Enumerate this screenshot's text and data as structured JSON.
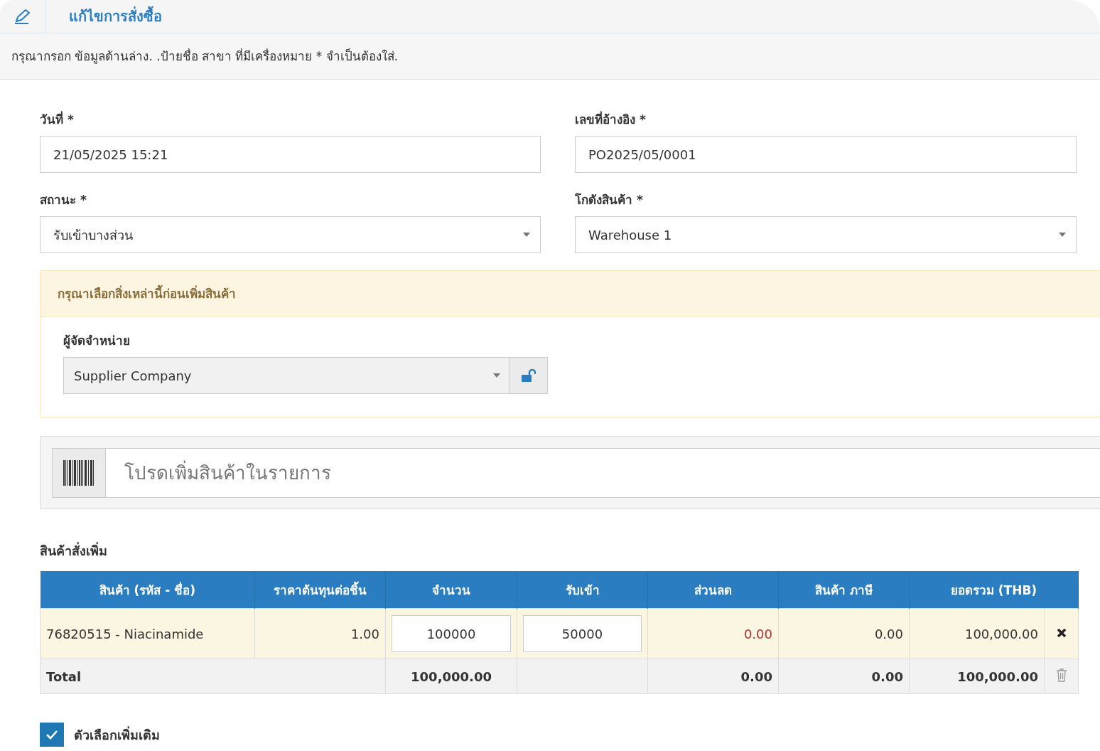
{
  "header": {
    "title": "แก้ไขการสั่งซื้อ"
  },
  "intro": "กรุณากรอก ข้อมูลด้านล่าง. .ป้ายชื่อ สาขา ที่มีเครื่องหมาย * จำเป็นต้องใส่.",
  "fields": [
    {
      "label": "วันที่ *",
      "kind": "text",
      "value": "21/05/2025 15:21"
    },
    {
      "label": "เลขที่อ้างอิง *",
      "kind": "text",
      "value": "PO2025/05/0001"
    },
    {
      "label": "สถานะ *",
      "kind": "select",
      "value": "รับเข้าบางส่วน"
    },
    {
      "label": "โกดังสินค้า *",
      "kind": "select",
      "value": "Warehouse 1"
    }
  ],
  "notice": {
    "heading": "กรุณาเลือกสิ่งเหล่านี้ก่อนเพิ่มสินค้า",
    "supplier_label": "ผู้จัดจำหน่าย",
    "supplier_value": "Supplier Company"
  },
  "product_search": {
    "placeholder": "โปรดเพิ่มสินค้าในรายการ"
  },
  "table": {
    "title": "สินค้าสั่งเพิ่ม",
    "columns": [
      "สินค้า (รหัส - ชื่อ)",
      "ราคาต้นทุนต่อชิ้น",
      "จำนวน",
      "รับเข้า",
      "ส่วนลด",
      "สินค้า ภาษี",
      "ยอดรวม (THB)"
    ],
    "rows": [
      {
        "cells": [
          {
            "kind": "text",
            "value": "76820515 - Niacinamide"
          },
          {
            "kind": "number",
            "value": "1.00"
          },
          {
            "kind": "input",
            "value": "100000"
          },
          {
            "kind": "input",
            "value": "50000"
          },
          {
            "kind": "discount",
            "value": "0.00"
          },
          {
            "kind": "number",
            "value": "0.00"
          },
          {
            "kind": "number",
            "value": "100,000.00"
          }
        ]
      }
    ],
    "total": {
      "label": "Total",
      "quantity": "100,000.00",
      "discount": "0.00",
      "tax": "0.00",
      "amount": "100,000.00"
    }
  },
  "more_options": {
    "label": "ตัวเลือกเพิ่มเติม",
    "checked": true
  }
}
